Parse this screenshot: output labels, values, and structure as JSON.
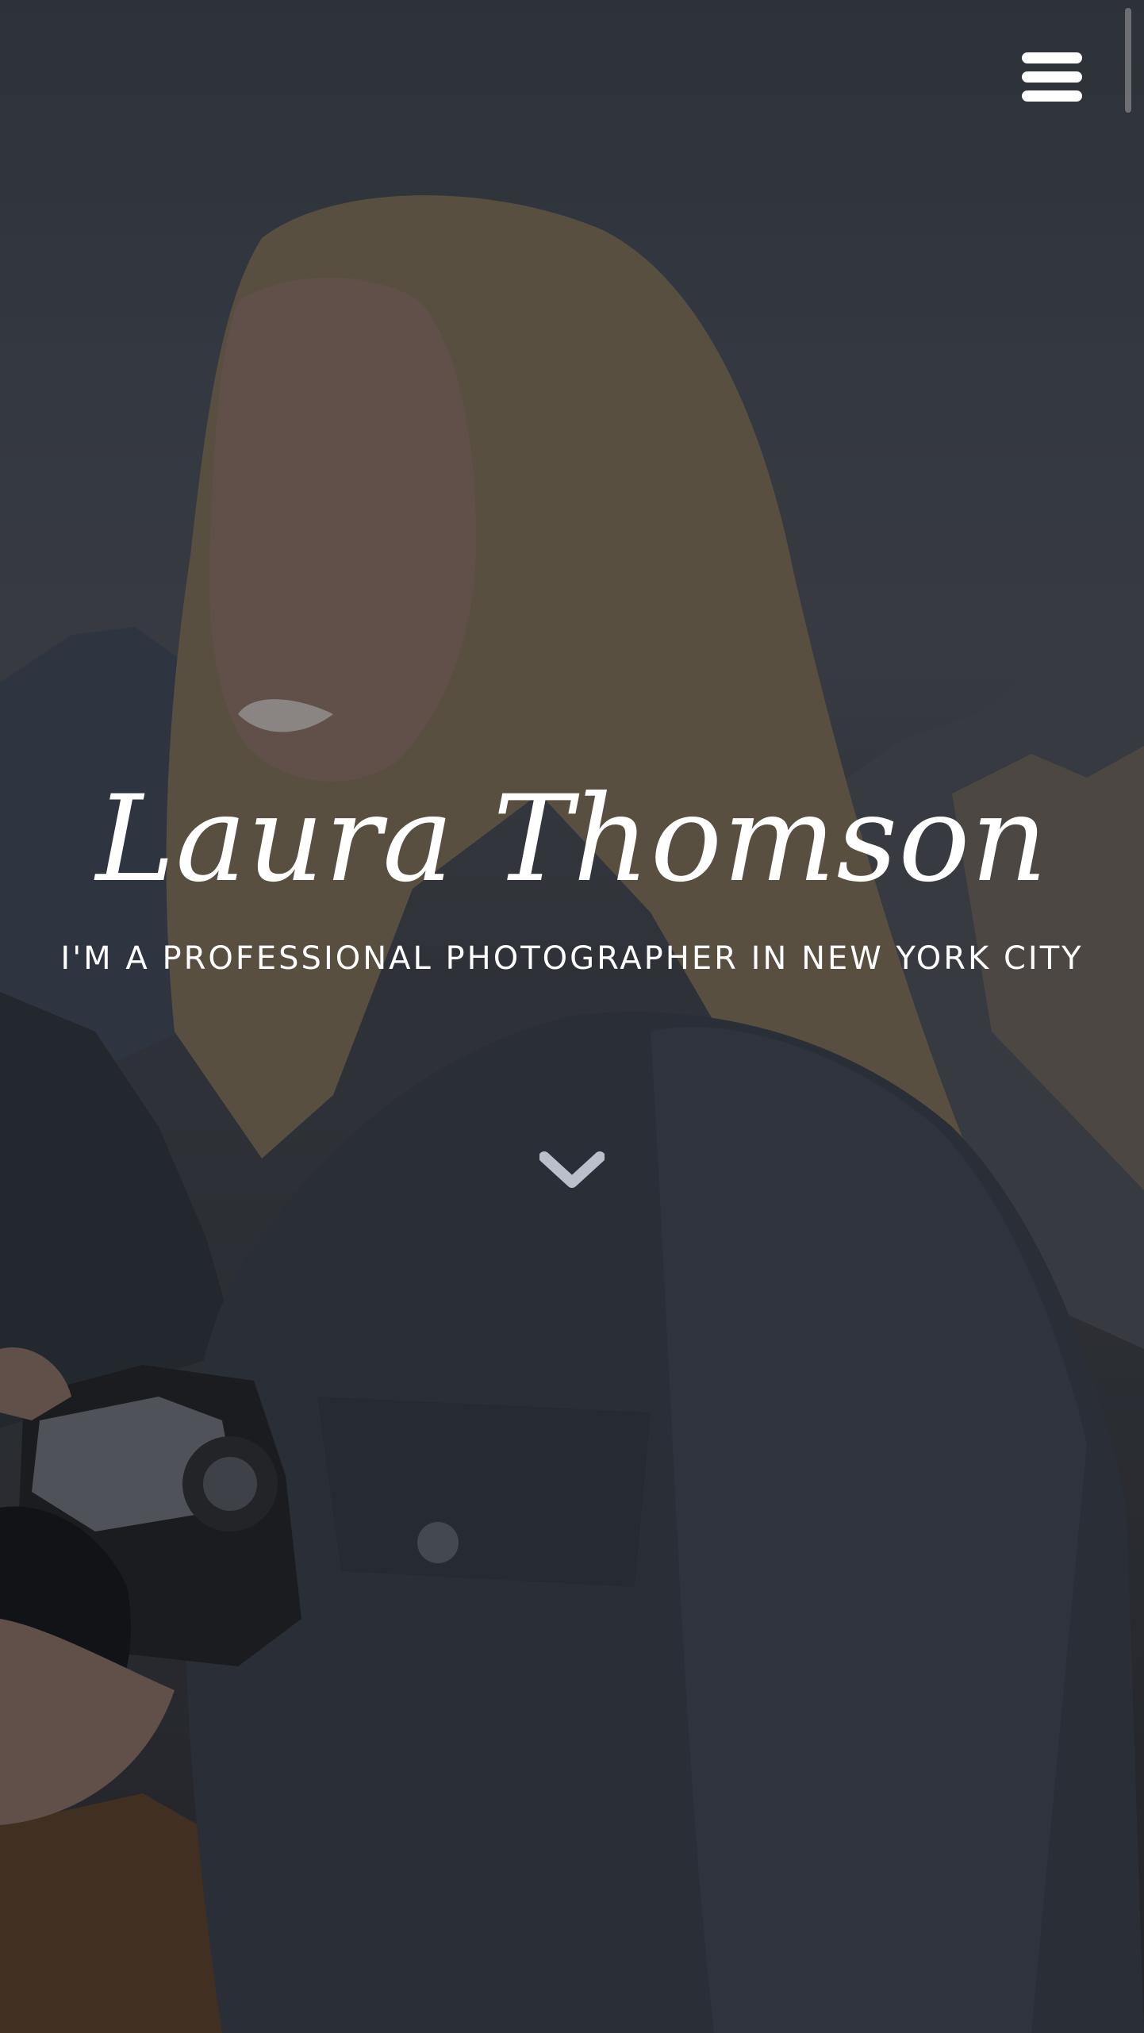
{
  "header": {
    "menu_icon": "hamburger-menu-icon"
  },
  "hero": {
    "name": "Laura Thomson",
    "tagline": "I'M A PROFESSIONAL PHOTOGRAPHER IN NEW YORK CITY",
    "scroll_icon": "chevron-down-icon"
  },
  "colors": {
    "text": "#ffffff",
    "chevron": "#b9c0cc",
    "overlay": "#14161c"
  }
}
